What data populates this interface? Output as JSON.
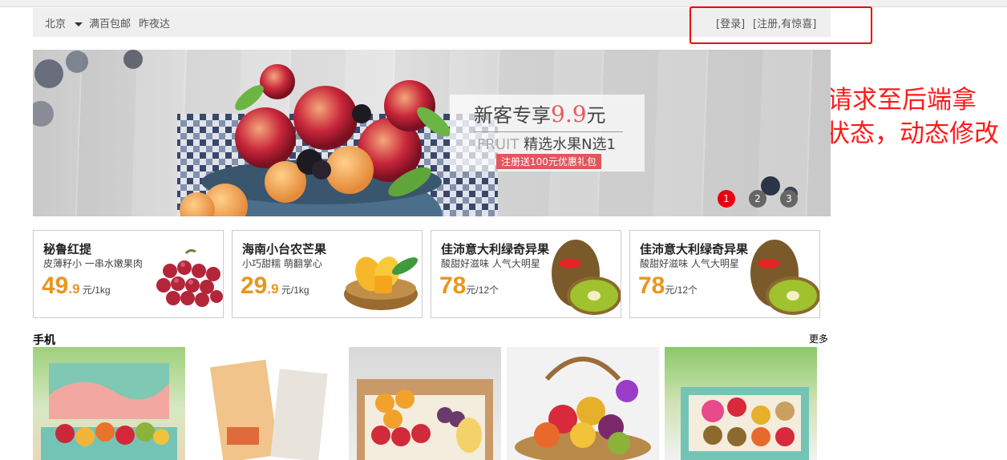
{
  "topbar": {
    "city": "北京",
    "free_shipping": "满百包邮",
    "express": "昨夜达",
    "login": "[登录]",
    "register": "[注册,有惊喜]"
  },
  "annotation": {
    "text": "ajax发请求至后端拿回登陆状态，动态修改此区域",
    "color": "#ff1a1a"
  },
  "banner": {
    "headline_prefix": "新客专享",
    "headline_price": "9.9",
    "headline_suffix": "元",
    "subline_en": "FRUIT",
    "subline_cn": " 精选水果N选1",
    "tag": "注册送100元优惠礼包",
    "dots": [
      "1",
      "2",
      "3"
    ],
    "active_dot": 0
  },
  "cards": [
    {
      "title": "秘鲁红提",
      "subtitle": "皮薄籽小 一串水嫩果肉",
      "price_int": "49",
      "price_dec": ".9",
      "unit": " 元/1kg",
      "fruit": "grape"
    },
    {
      "title": "海南小台农芒果",
      "subtitle": "小巧甜糯 萌翻掌心",
      "price_int": "29",
      "price_dec": ".9",
      "unit": " 元/1kg",
      "fruit": "mango"
    },
    {
      "title": "佳沛意大利绿奇异果",
      "subtitle": "酸甜好滋味 人气大明星",
      "price_int": "78",
      "price_dec": "",
      "unit": "元/12个",
      "fruit": "kiwi"
    },
    {
      "title": "佳沛意大利绿奇异果",
      "subtitle": "酸甜好滋味 人气大明星",
      "price_int": "78",
      "price_dec": "",
      "unit": "元/12个",
      "fruit": "kiwi"
    }
  ],
  "section": {
    "title": "手机",
    "more": "更多"
  },
  "colors": {
    "accent_price": "#e8961d",
    "active_dot": "#e60012",
    "promo_tag": "#e2565c"
  }
}
